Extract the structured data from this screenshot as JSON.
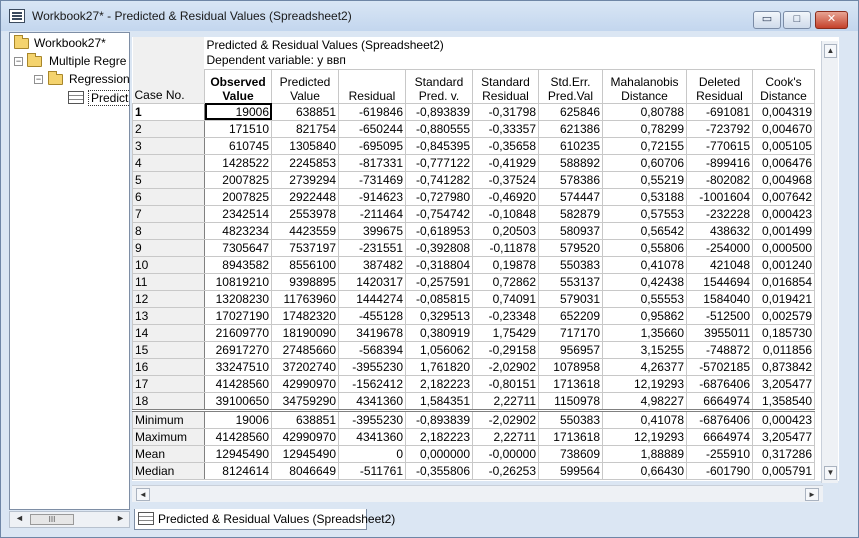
{
  "window": {
    "title": "Workbook27* - Predicted & Residual Values (Spreadsheet2)"
  },
  "window_buttons": {
    "minimize": "▭",
    "maximize": "□",
    "close": "✕"
  },
  "tree": {
    "root": "Workbook27*",
    "child1": "Multiple Regre",
    "child2": "Regression",
    "child3": "Predict"
  },
  "sheet": {
    "title": "Predicted & Residual Values (Spreadsheet2)",
    "subtitle": "Dependent variable: y ввп",
    "case_header": "Case No.",
    "columns": [
      [
        "Observed",
        "Value"
      ],
      [
        "Predicted",
        "Value"
      ],
      [
        "Residual",
        ""
      ],
      [
        "Standard",
        "Pred. v."
      ],
      [
        "Standard",
        "Residual"
      ],
      [
        "Std.Err.",
        "Pred.Val"
      ],
      [
        "Mahalanobis",
        "Distance"
      ],
      [
        "Deleted",
        "Residual"
      ],
      [
        "Cook's",
        "Distance"
      ]
    ],
    "rows": [
      [
        "1",
        "19006",
        "638851",
        "-619846",
        "-0,893839",
        "-0,31798",
        "625846",
        "0,80788",
        "-691081",
        "0,004319"
      ],
      [
        "2",
        "171510",
        "821754",
        "-650244",
        "-0,880555",
        "-0,33357",
        "621386",
        "0,78299",
        "-723792",
        "0,004670"
      ],
      [
        "3",
        "610745",
        "1305840",
        "-695095",
        "-0,845395",
        "-0,35658",
        "610235",
        "0,72155",
        "-770615",
        "0,005105"
      ],
      [
        "4",
        "1428522",
        "2245853",
        "-817331",
        "-0,777122",
        "-0,41929",
        "588892",
        "0,60706",
        "-899416",
        "0,006476"
      ],
      [
        "5",
        "2007825",
        "2739294",
        "-731469",
        "-0,741282",
        "-0,37524",
        "578386",
        "0,55219",
        "-802082",
        "0,004968"
      ],
      [
        "6",
        "2007825",
        "2922448",
        "-914623",
        "-0,727980",
        "-0,46920",
        "574447",
        "0,53188",
        "-1001604",
        "0,007642"
      ],
      [
        "7",
        "2342514",
        "2553978",
        "-211464",
        "-0,754742",
        "-0,10848",
        "582879",
        "0,57553",
        "-232228",
        "0,000423"
      ],
      [
        "8",
        "4823234",
        "4423559",
        "399675",
        "-0,618953",
        "0,20503",
        "580937",
        "0,56542",
        "438632",
        "0,001499"
      ],
      [
        "9",
        "7305647",
        "7537197",
        "-231551",
        "-0,392808",
        "-0,11878",
        "579520",
        "0,55806",
        "-254000",
        "0,000500"
      ],
      [
        "10",
        "8943582",
        "8556100",
        "387482",
        "-0,318804",
        "0,19878",
        "550383",
        "0,41078",
        "421048",
        "0,001240"
      ],
      [
        "11",
        "10819210",
        "9398895",
        "1420317",
        "-0,257591",
        "0,72862",
        "553137",
        "0,42438",
        "1544694",
        "0,016854"
      ],
      [
        "12",
        "13208230",
        "11763960",
        "1444274",
        "-0,085815",
        "0,74091",
        "579031",
        "0,55553",
        "1584040",
        "0,019421"
      ],
      [
        "13",
        "17027190",
        "17482320",
        "-455128",
        "0,329513",
        "-0,23348",
        "652209",
        "0,95862",
        "-512500",
        "0,002579"
      ],
      [
        "14",
        "21609770",
        "18190090",
        "3419678",
        "0,380919",
        "1,75429",
        "717170",
        "1,35660",
        "3955011",
        "0,185730"
      ],
      [
        "15",
        "26917270",
        "27485660",
        "-568394",
        "1,056062",
        "-0,29158",
        "956957",
        "3,15255",
        "-748872",
        "0,011856"
      ],
      [
        "16",
        "33247510",
        "37202740",
        "-3955230",
        "1,761820",
        "-2,02902",
        "1078958",
        "4,26377",
        "-5702185",
        "0,873842"
      ],
      [
        "17",
        "41428560",
        "42990970",
        "-1562412",
        "2,182223",
        "-0,80151",
        "1713618",
        "12,19293",
        "-6876406",
        "3,205477"
      ],
      [
        "18",
        "39100650",
        "34759290",
        "4341360",
        "1,584351",
        "2,22711",
        "1150978",
        "4,98227",
        "6664974",
        "1,358540"
      ]
    ],
    "summary": [
      [
        "Minimum",
        "19006",
        "638851",
        "-3955230",
        "-0,893839",
        "-2,02902",
        "550383",
        "0,41078",
        "-6876406",
        "0,000423"
      ],
      [
        "Maximum",
        "41428560",
        "42990970",
        "4341360",
        "2,182223",
        "2,22711",
        "1713618",
        "12,19293",
        "6664974",
        "3,205477"
      ],
      [
        "Mean",
        "12945490",
        "12945490",
        "0",
        "0,000000",
        "-0,00000",
        "738609",
        "1,88889",
        "-255910",
        "0,317286"
      ],
      [
        "Median",
        "8124614",
        "8046649",
        "-511761",
        "-0,355806",
        "-0,26253",
        "599564",
        "0,66430",
        "-601790",
        "0,005791"
      ]
    ]
  },
  "tabs": [
    "Predicted & Residual Values (Spreadsheet2)"
  ],
  "scroll": {
    "left": "◄",
    "right": "►",
    "up": "▲",
    "down": "▼",
    "grip": "III"
  }
}
